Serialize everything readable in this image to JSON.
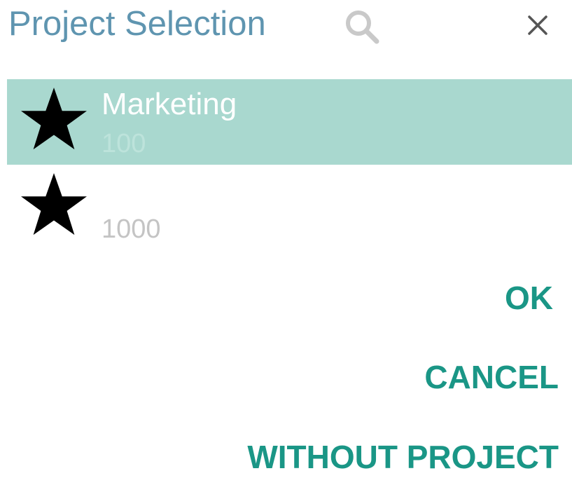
{
  "dialog": {
    "title": "Project Selection",
    "search_icon": "search-icon",
    "close_icon": "close-icon"
  },
  "projects": [
    {
      "name": "Marketing",
      "code": "100",
      "selected": true,
      "icon": "star-icon"
    },
    {
      "name": "",
      "code": "1000",
      "selected": false,
      "icon": "star-icon"
    }
  ],
  "actions": {
    "ok_label": "OK",
    "cancel_label": "CANCEL",
    "without_project_label": "WITHOUT PROJECT"
  },
  "colors": {
    "title": "#5f95b0",
    "selected_row": "#a9d8cf",
    "action_text": "#1a9686",
    "secondary_text": "#c4c4c4"
  }
}
